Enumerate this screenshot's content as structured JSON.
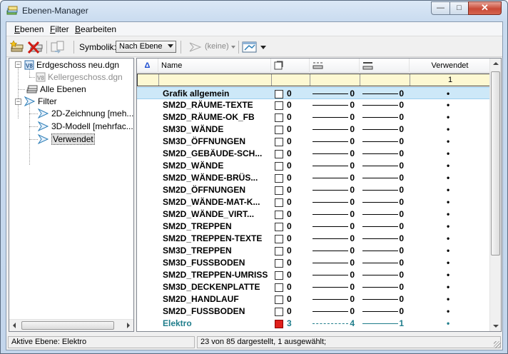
{
  "window": {
    "title": "Ebenen-Manager",
    "min_label": "—",
    "max_label": "□",
    "close_label": "✕"
  },
  "menu": [
    {
      "label": "Ebenen",
      "key": "E"
    },
    {
      "label": "Filter",
      "key": "F"
    },
    {
      "label": "Bearbeiten",
      "key": "B"
    }
  ],
  "toolbar": {
    "symbolik_label": "Symbolik:",
    "symbolik_value": "Nach Ebene",
    "keine_label": "(keine)"
  },
  "tree": {
    "root": "Erdgeschoss neu.dgn",
    "ref": "Kellergeschoss.dgn",
    "all": "Alle Ebenen",
    "filter": "Filter",
    "filters": [
      "2D-Zeichnung [meh...",
      "3D-Modell [mehrfac...",
      "Verwendet"
    ]
  },
  "grid": {
    "headers": {
      "sort": "Δ",
      "name": "Name",
      "used": "Verwendet"
    },
    "filter_used_value": "1",
    "rows": [
      {
        "name": "Grafik allgemein",
        "color": "0",
        "style": "0",
        "weight": "0",
        "used": "•",
        "selected": true
      },
      {
        "name": "SM2D_RÄUME-TEXTE",
        "color": "0",
        "style": "0",
        "weight": "0",
        "used": "•"
      },
      {
        "name": "SM2D_RÄUME-OK_FB",
        "color": "0",
        "style": "0",
        "weight": "0",
        "used": "•"
      },
      {
        "name": "SM3D_WÄNDE",
        "color": "0",
        "style": "0",
        "weight": "0",
        "used": "•"
      },
      {
        "name": "SM3D_ÖFFNUNGEN",
        "color": "0",
        "style": "0",
        "weight": "0",
        "used": "•"
      },
      {
        "name": "SM2D_GEBÄUDE-SCH...",
        "color": "0",
        "style": "0",
        "weight": "0",
        "used": "•"
      },
      {
        "name": "SM2D_WÄNDE",
        "color": "0",
        "style": "0",
        "weight": "0",
        "used": "•"
      },
      {
        "name": "SM2D_WÄNDE-BRÜS...",
        "color": "0",
        "style": "0",
        "weight": "0",
        "used": "•"
      },
      {
        "name": "SM2D_ÖFFNUNGEN",
        "color": "0",
        "style": "0",
        "weight": "0",
        "used": "•"
      },
      {
        "name": "SM2D_WÄNDE-MAT-K...",
        "color": "0",
        "style": "0",
        "weight": "0",
        "used": "•"
      },
      {
        "name": "SM2D_WÄNDE_VIRT...",
        "color": "0",
        "style": "0",
        "weight": "0",
        "used": "•"
      },
      {
        "name": "SM2D_TREPPEN",
        "color": "0",
        "style": "0",
        "weight": "0",
        "used": "•"
      },
      {
        "name": "SM2D_TREPPEN-TEXTE",
        "color": "0",
        "style": "0",
        "weight": "0",
        "used": "•"
      },
      {
        "name": "SM3D_TREPPEN",
        "color": "0",
        "style": "0",
        "weight": "0",
        "used": "•"
      },
      {
        "name": "SM3D_FUSSBODEN",
        "color": "0",
        "style": "0",
        "weight": "0",
        "used": "•"
      },
      {
        "name": "SM2D_TREPPEN-UMRISS",
        "color": "0",
        "style": "0",
        "weight": "0",
        "used": "•"
      },
      {
        "name": "SM3D_DECKENPLATTE",
        "color": "0",
        "style": "0",
        "weight": "0",
        "used": "•"
      },
      {
        "name": "SM2D_HANDLAUF",
        "color": "0",
        "style": "0",
        "weight": "0",
        "used": "•"
      },
      {
        "name": "SM2D_FUSSBODEN",
        "color": "0",
        "style": "0",
        "weight": "0",
        "used": "•"
      },
      {
        "name": "Elektro",
        "color": "3",
        "style": "4",
        "weight": "1",
        "used": "•",
        "active": true
      }
    ]
  },
  "status": {
    "active_layer": "Aktive Ebene: Elektro",
    "count": "23 von 85 dargestellt, 1 ausgewählt;"
  },
  "colors": {
    "accent": "#1f7d8b",
    "filter_bg": "#fdf8d2",
    "selected_bg": "#cde8f8",
    "elektro_swatch": "#e0201c"
  }
}
